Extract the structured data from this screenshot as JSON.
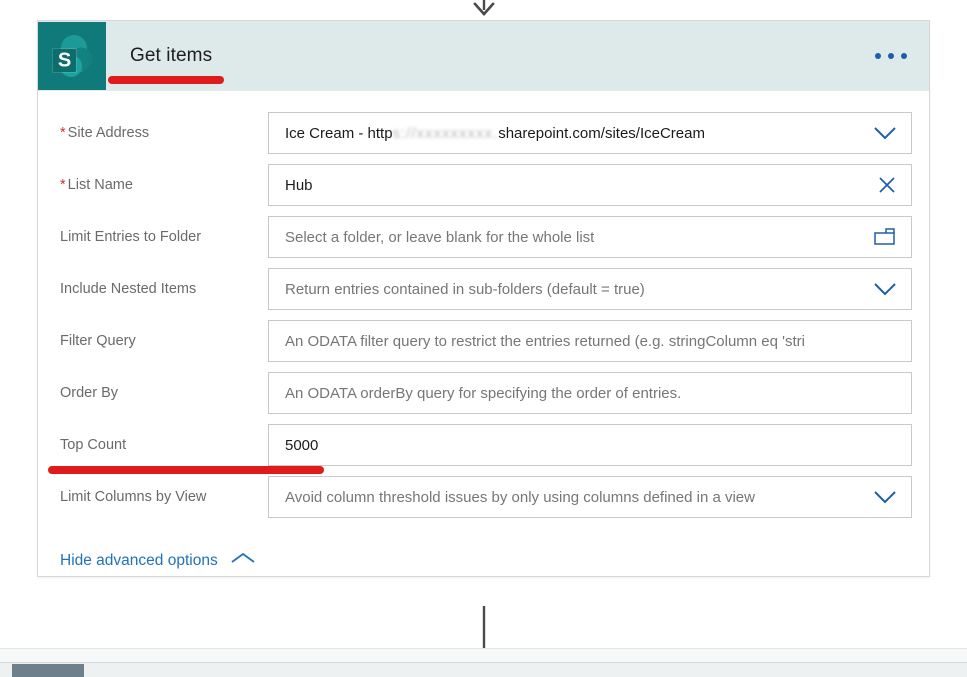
{
  "flow": {
    "arrow_top": "down-arrow",
    "arrow_bottom": "down-arrow"
  },
  "card": {
    "app_icon": "sharepoint-icon",
    "title": "Get items",
    "overflow_menu": "ellipsis-menu",
    "header_bg": "#dee9e9",
    "icon_bg": "#0f7a79",
    "accent_blue": "#1d5fad",
    "link_blue": "#2272b9",
    "required_red": "#c0392b",
    "annotation_red": "#e01b1b",
    "fields": [
      {
        "label": "Site Address",
        "required": true,
        "value": "Ice Cream - http",
        "value_redacted": "s://xxxxxxxxx.",
        "value_tail": "sharepoint.com/sites/IceCream",
        "is_placeholder": false,
        "icon": "chevron-down-icon"
      },
      {
        "label": "List Name",
        "required": true,
        "value": "Hub",
        "is_placeholder": false,
        "icon": "close-icon"
      },
      {
        "label": "Limit Entries to Folder",
        "required": false,
        "value": "Select a folder, or leave blank for the whole list",
        "is_placeholder": true,
        "icon": "folder-icon"
      },
      {
        "label": "Include Nested Items",
        "required": false,
        "value": "Return entries contained in sub-folders (default = true)",
        "is_placeholder": true,
        "icon": "chevron-down-icon"
      },
      {
        "label": "Filter Query",
        "required": false,
        "value": "An ODATA filter query to restrict the entries returned (e.g. stringColumn eq 'stri",
        "is_placeholder": true,
        "icon": "none"
      },
      {
        "label": "Order By",
        "required": false,
        "value": "An ODATA orderBy query for specifying the order of entries.",
        "is_placeholder": true,
        "icon": "none"
      },
      {
        "label": "Top Count",
        "required": false,
        "value": "5000",
        "is_placeholder": false,
        "icon": "none"
      },
      {
        "label": "Limit Columns by View",
        "required": false,
        "value": "Avoid column threshold issues by only using columns defined in a view",
        "is_placeholder": true,
        "icon": "chevron-down-icon"
      }
    ],
    "advanced_options": {
      "label": "Hide advanced options",
      "icon": "chevron-up-icon"
    }
  },
  "annotations": [
    {
      "name": "title-underline",
      "color": "#e01b1b"
    },
    {
      "name": "top-count-underline",
      "color": "#e01b1b"
    }
  ],
  "scrollbar": {
    "name": "horizontal-scrollbar",
    "thumb": "scrollbar-thumb"
  }
}
